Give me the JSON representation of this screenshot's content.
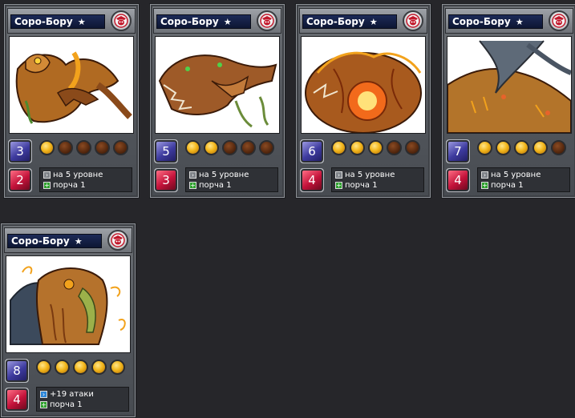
{
  "colors": {
    "background": "#26262a",
    "cost_gem": "#3d3a9e",
    "power_gem": "#c3123a",
    "star_on": "#f3b71c",
    "star_off": "#5a2b10"
  },
  "cards": [
    {
      "name": "Соро-Бору",
      "name_star": "★",
      "faction_icon": "skull-emblem-icon",
      "cost": "3",
      "power": "2",
      "stars_on": 1,
      "stars_total": 5,
      "bonuses": [
        {
          "icon": "level-arrow-icon",
          "text": "на 5 уровне"
        },
        {
          "icon": "plus-icon",
          "text": "порча 1"
        }
      ]
    },
    {
      "name": "Соро-Бору",
      "name_star": "★",
      "faction_icon": "skull-emblem-icon",
      "cost": "5",
      "power": "3",
      "stars_on": 2,
      "stars_total": 5,
      "bonuses": [
        {
          "icon": "level-arrow-icon",
          "text": "на 5 уровне"
        },
        {
          "icon": "plus-icon",
          "text": "порча 1"
        }
      ]
    },
    {
      "name": "Соро-Бору",
      "name_star": "★",
      "faction_icon": "skull-emblem-icon",
      "cost": "6",
      "power": "4",
      "stars_on": 3,
      "stars_total": 5,
      "bonuses": [
        {
          "icon": "level-arrow-icon",
          "text": "на 5 уровне"
        },
        {
          "icon": "plus-icon",
          "text": "порча 1"
        }
      ]
    },
    {
      "name": "Соро-Бору",
      "name_star": "★",
      "faction_icon": "skull-emblem-icon",
      "cost": "7",
      "power": "4",
      "stars_on": 4,
      "stars_total": 5,
      "bonuses": [
        {
          "icon": "level-arrow-icon",
          "text": "на 5 уровне"
        },
        {
          "icon": "plus-icon",
          "text": "порча 1"
        }
      ]
    },
    {
      "name": "Соро-Бору",
      "name_star": "★",
      "faction_icon": "skull-emblem-icon",
      "cost": "8",
      "power": "4",
      "stars_on": 5,
      "stars_total": 5,
      "bonuses": [
        {
          "icon": "attack-arrow-icon",
          "text": "+19 атаки"
        },
        {
          "icon": "plus-icon",
          "text": "порча 1"
        }
      ]
    }
  ]
}
